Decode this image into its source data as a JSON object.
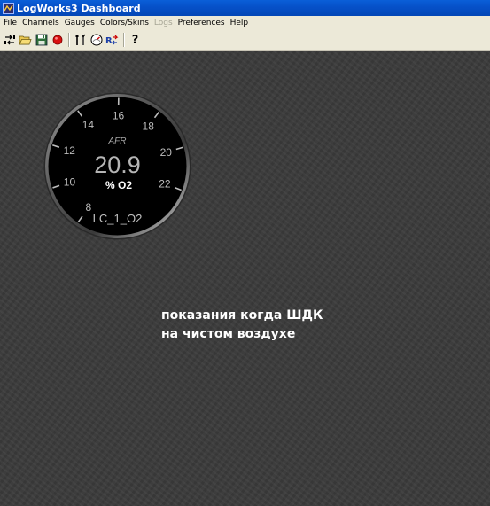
{
  "window": {
    "title": "LogWorks3 Dashboard"
  },
  "menubar": {
    "items": [
      {
        "label": "File",
        "enabled": true
      },
      {
        "label": "Channels",
        "enabled": true
      },
      {
        "label": "Gauges",
        "enabled": true
      },
      {
        "label": "Colors/Skins",
        "enabled": true
      },
      {
        "label": "Logs",
        "enabled": false
      },
      {
        "label": "Preferences",
        "enabled": true
      },
      {
        "label": "Help",
        "enabled": true
      }
    ]
  },
  "toolbar": {
    "icons": [
      "connect-icon",
      "open-folder-icon",
      "save-icon",
      "record-icon",
      "tools-icon",
      "gauge-settings-icon",
      "channel-sync-icon",
      "help-icon"
    ],
    "help_label": "?"
  },
  "gauge": {
    "label": "AFR",
    "value": "20.9",
    "units": "% O2",
    "channel": "LC_1_O2",
    "ticks": [
      "8",
      "10",
      "12",
      "14",
      "16",
      "18",
      "20",
      "22"
    ]
  },
  "caption": {
    "line1": "показания когда ШДК",
    "line2": "на чистом воздухе"
  },
  "colors": {
    "titlebar": "#0650c8",
    "menubar": "#ece9d8",
    "workspace": "#3b3b3b",
    "gauge_face": "#000000",
    "gauge_text": "#bfbfbf",
    "record_red": "#d81010"
  }
}
